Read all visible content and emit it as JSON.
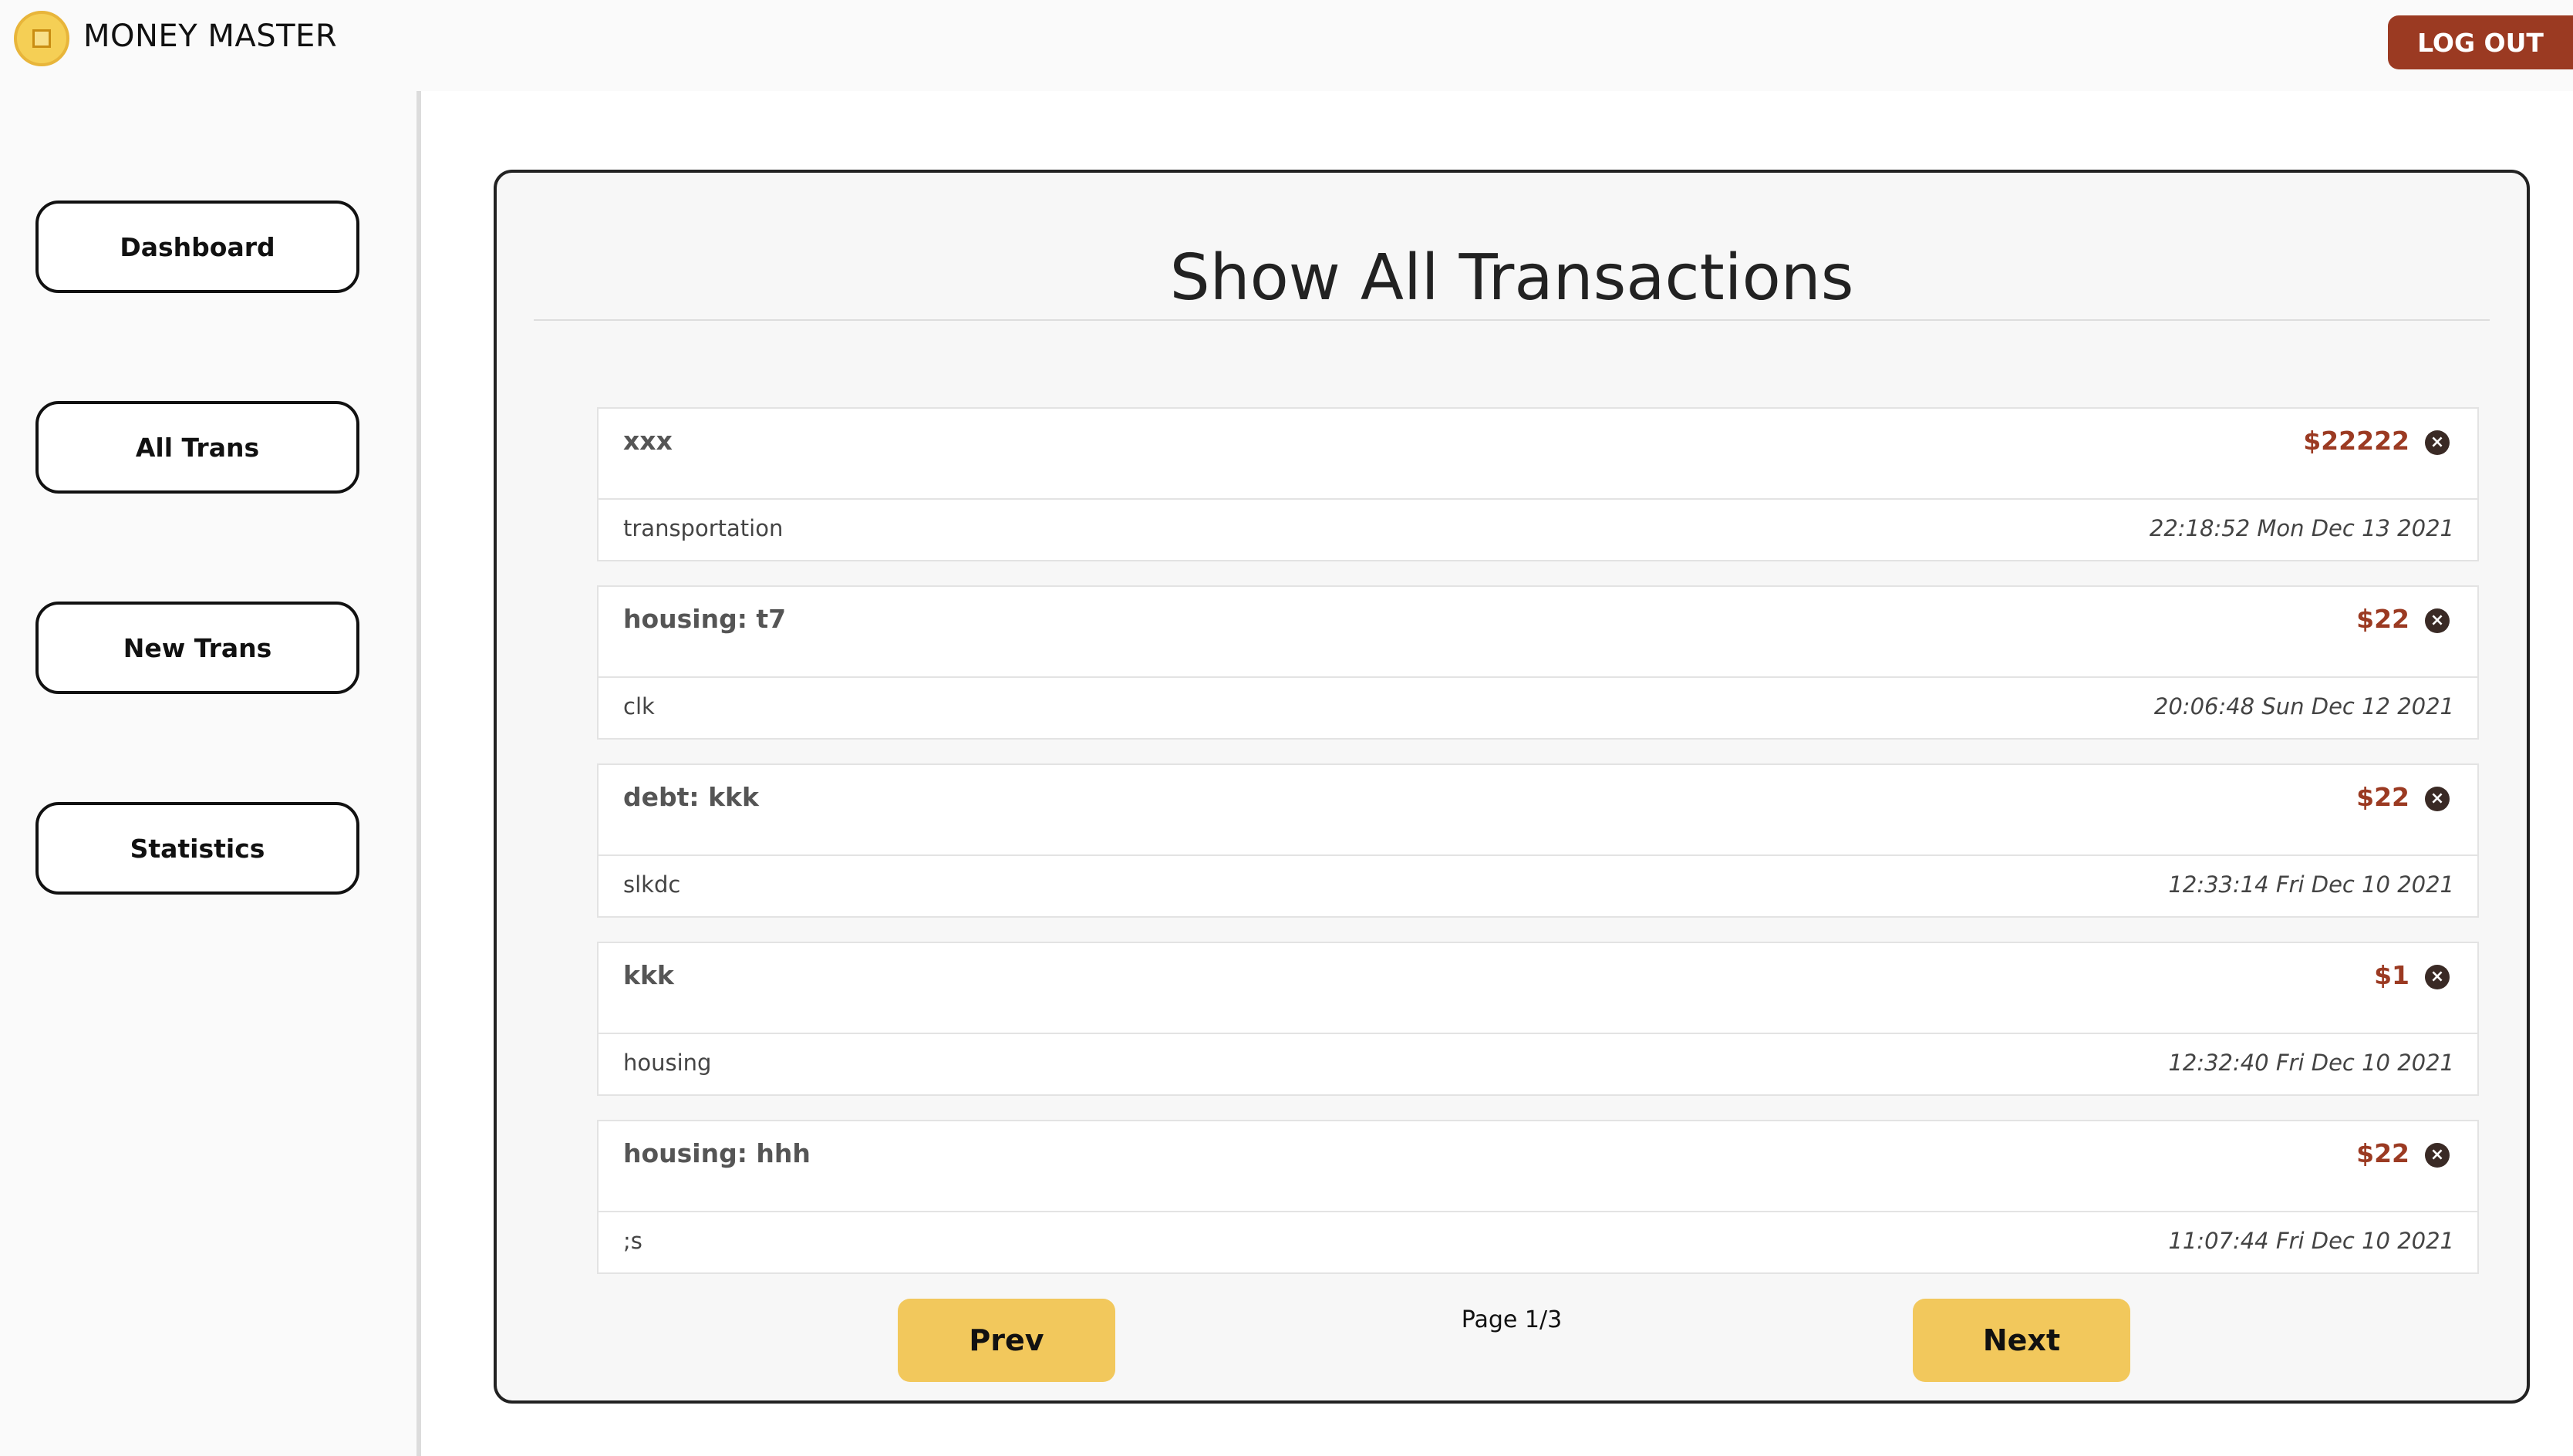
{
  "header": {
    "brand": "MONEY MASTER",
    "logout_label": "LOG OUT"
  },
  "sidebar": {
    "items": [
      {
        "label": "Dashboard"
      },
      {
        "label": "All Trans"
      },
      {
        "label": "New Trans"
      },
      {
        "label": "Statistics"
      }
    ]
  },
  "main": {
    "title": "Show All Transactions",
    "transactions": [
      {
        "name": "xxx",
        "amount": "$22222",
        "category": "transportation",
        "time": "22:18:52 Mon Dec 13 2021"
      },
      {
        "name": "housing: t7",
        "amount": "$22",
        "category": "clk",
        "time": "20:06:48 Sun Dec 12 2021"
      },
      {
        "name": "debt: kkk",
        "amount": "$22",
        "category": "slkdc",
        "time": "12:33:14 Fri Dec 10 2021"
      },
      {
        "name": "kkk",
        "amount": "$1",
        "category": "housing",
        "time": "12:32:40 Fri Dec 10 2021"
      },
      {
        "name": "housing: hhh",
        "amount": "$22",
        "category": ";s",
        "time": "11:07:44 Fri Dec 10 2021"
      }
    ],
    "pagination": {
      "prev_label": "Prev",
      "next_label": "Next",
      "page_indicator": "Page 1/3"
    }
  },
  "colors": {
    "accent": "#9b3a22",
    "button_yellow": "#f2c85c",
    "logo": "#f5cf55"
  }
}
